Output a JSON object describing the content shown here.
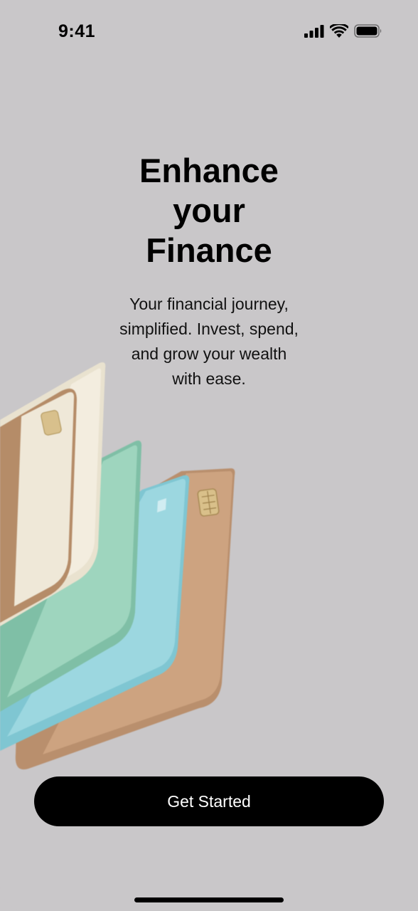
{
  "status_bar": {
    "time": "9:41",
    "icons": [
      "signal-icon",
      "wifi-icon",
      "battery-icon"
    ]
  },
  "hero": {
    "title_line1": "Enhance",
    "title_line2": "your",
    "title_line3": "Finance",
    "subtitle_line1": "Your financial journey,",
    "subtitle_line2": "simplified. Invest, spend,",
    "subtitle_line3": "and grow your wealth",
    "subtitle_line4": "with ease."
  },
  "illustration": {
    "icon": "stacked-cards-illustration",
    "card_colors": [
      "#ece6d6",
      "#b08e6c",
      "#8fcbb4",
      "#7cc4cf",
      "#c79c7a"
    ]
  },
  "cta": {
    "label": "Get Started"
  },
  "colors": {
    "background": "#c9c7c9",
    "button": "#000000",
    "button_text": "#ffffff",
    "text": "#000000"
  }
}
